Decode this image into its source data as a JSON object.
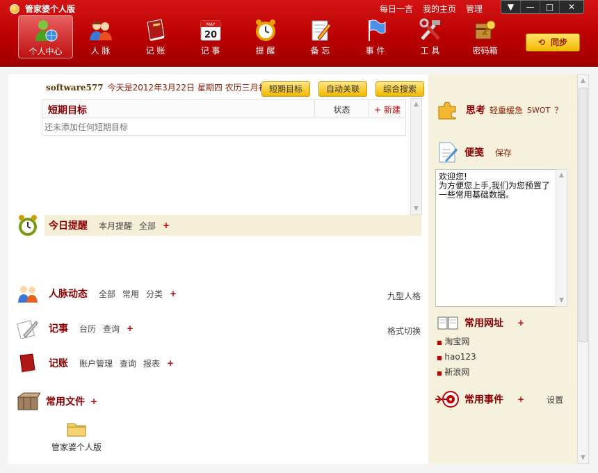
{
  "window": {
    "title": "管家婆个人版",
    "links": [
      "每日一言",
      "我的主页",
      "管理"
    ],
    "controls": {
      "dropdown": "▼",
      "minimize": "—",
      "maximize": "□",
      "close": "✕"
    }
  },
  "nav": {
    "items": [
      {
        "label": "个人中心",
        "icon": "user-globe-icon",
        "active": true
      },
      {
        "label": "人 脉",
        "icon": "people-icon"
      },
      {
        "label": "记 账",
        "icon": "ledger-book-icon"
      },
      {
        "label": "记 事",
        "icon": "calendar-icon",
        "badge_month": "MAY",
        "badge_day": "20"
      },
      {
        "label": "提 醒",
        "icon": "alarm-clock-icon"
      },
      {
        "label": "备 忘",
        "icon": "memo-pencil-icon"
      },
      {
        "label": "事 件",
        "icon": "flag-icon"
      },
      {
        "label": "工 具",
        "icon": "tools-icon"
      },
      {
        "label": "密码箱",
        "icon": "key-box-icon"
      }
    ],
    "sync_label": "同步"
  },
  "header": {
    "user": "software577",
    "date_text": "今天是2012年3月22日 星期四 农历三月初一",
    "buttons": [
      "短期目标",
      "自动关联",
      "综合搜索"
    ]
  },
  "goals": {
    "col_title": "短期目标",
    "col_status": "状态",
    "new_label": "+ 新建",
    "empty_text": "还未添加任何短期目标"
  },
  "reminder": {
    "title": "今日提醒",
    "links": [
      "本月提醒",
      "全部"
    ],
    "plus": "+"
  },
  "contacts": {
    "title": "人脉动态",
    "links": [
      "全部",
      "常用",
      "分类"
    ],
    "plus": "+",
    "right": "九型人格"
  },
  "notes": {
    "title": "记事",
    "links": [
      "台历",
      "查询"
    ],
    "plus": "+",
    "right": "格式切换"
  },
  "accounts": {
    "title": "记账",
    "links": [
      "账户管理",
      "查询",
      "报表"
    ],
    "plus": "+"
  },
  "files": {
    "title": "常用文件",
    "plus": "+",
    "items": [
      {
        "label": "管家婆个人版"
      }
    ]
  },
  "side": {
    "think": {
      "title": "思考",
      "links": [
        "轻重缓急",
        "SWOT",
        "？"
      ]
    },
    "memo": {
      "title": "便笺",
      "save": "保存",
      "text": "欢迎您!\n为方便您上手,我们为您预置了一些常用基础数据。"
    },
    "sites": {
      "title": "常用网址",
      "plus": "+",
      "items": [
        "淘宝网",
        "hao123",
        "新浪网"
      ]
    },
    "events": {
      "title": "常用事件",
      "plus": "+",
      "setting": "设置"
    }
  },
  "colors": {
    "brand_red": "#c00000",
    "gold": "#f0b800",
    "side_bg": "#f6f1dd"
  }
}
